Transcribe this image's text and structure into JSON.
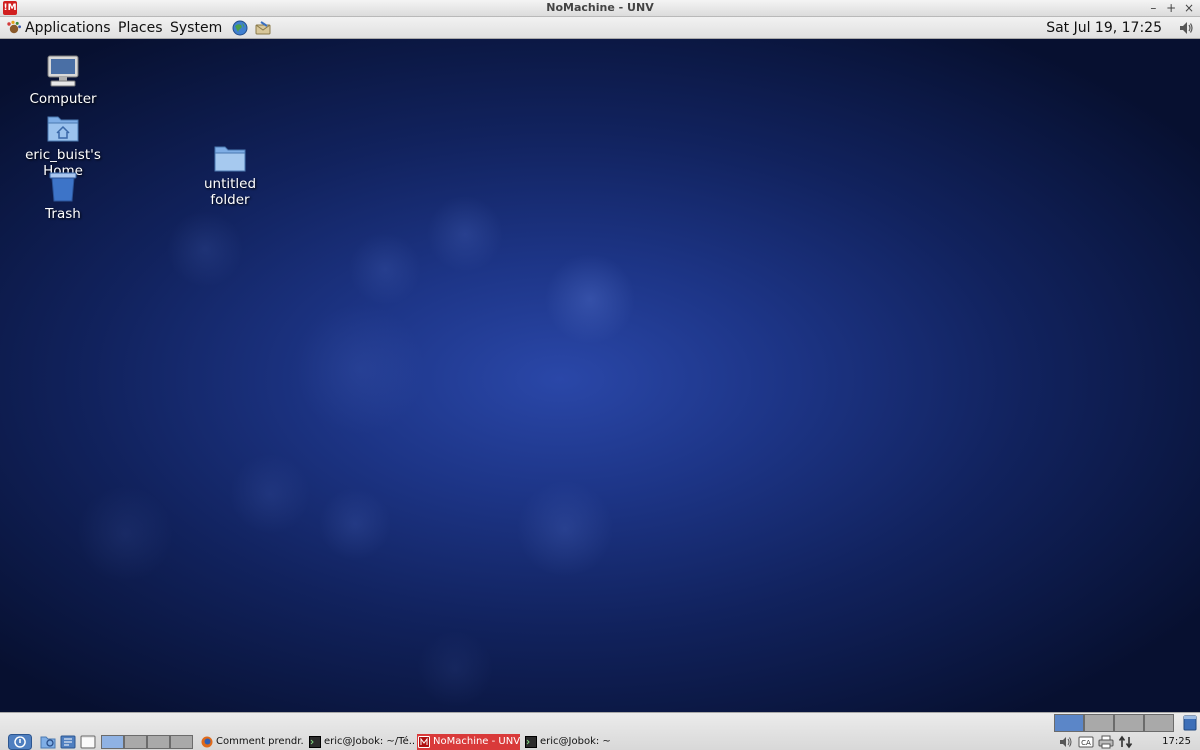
{
  "window": {
    "title": "NoMachine - UNV",
    "logo_text": "!M",
    "controls": [
      "–",
      "+",
      "×"
    ]
  },
  "top_panel": {
    "menus": [
      "Applications",
      "Places",
      "System"
    ],
    "clock": "Sat Jul 19, 17:25"
  },
  "desktop": {
    "icons": [
      {
        "label": "Computer"
      },
      {
        "label": "eric_buist's Home"
      },
      {
        "label": "Trash"
      },
      {
        "label": "untitled folder"
      }
    ]
  },
  "bottom_panel": {
    "tasks": [
      {
        "label": "Comment prendr..."
      },
      {
        "label": "eric@Jobok: ~/Té..."
      },
      {
        "label": "NoMachine - UNV"
      },
      {
        "label": "eric@Jobok: ~"
      }
    ],
    "clock": "17:25"
  },
  "colors": {
    "desktop_center": "#2a47a8",
    "desktop_edge": "#071030",
    "active_task": "#d93a3a",
    "workspace_active": "#5b86c8",
    "workspace_inactive": "#a9a9a9"
  }
}
